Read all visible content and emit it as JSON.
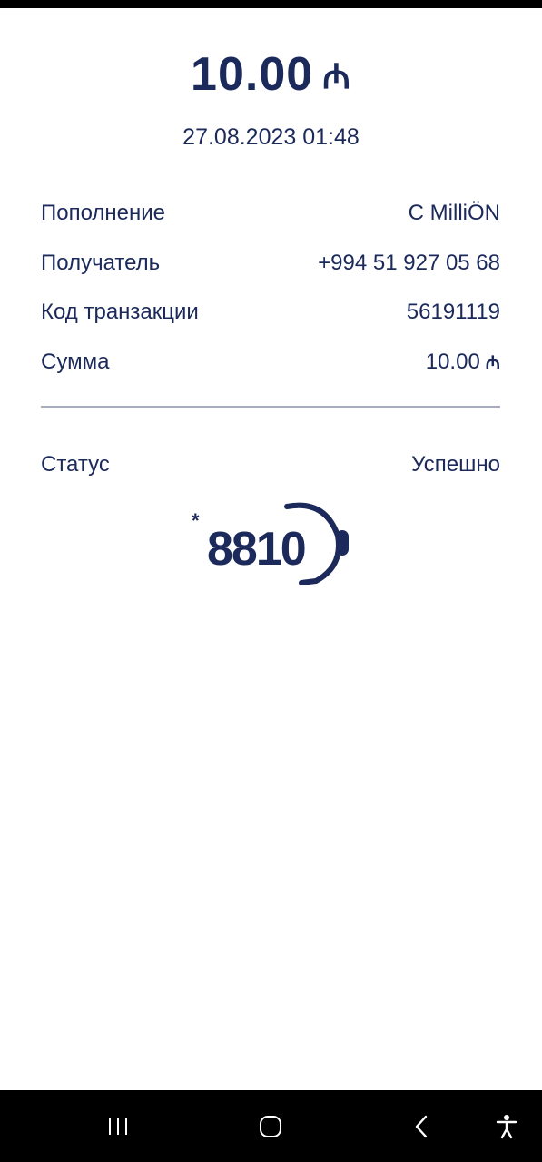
{
  "receipt": {
    "amount": "10.00",
    "currency_symbol": "₼",
    "datetime": "27.08.2023 01:48",
    "rows": [
      {
        "label": "Пополнение",
        "value": "C MilliÖN"
      },
      {
        "label": "Получатель",
        "value": "+994 51 927 05 68"
      },
      {
        "label": "Код транзакции",
        "value": "56191119"
      },
      {
        "label": "Сумма",
        "value": "10.00"
      }
    ],
    "status_label": "Статус",
    "status_value": "Успешно"
  },
  "logo": {
    "text": "8810",
    "star": "*"
  },
  "colors": {
    "primary": "#1b2a5a",
    "divider": "#a9adc0",
    "background": "#ffffff",
    "navbar": "#000000"
  },
  "navbar": {
    "icons": [
      "recent-apps-icon",
      "home-icon",
      "back-icon",
      "accessibility-icon"
    ]
  }
}
